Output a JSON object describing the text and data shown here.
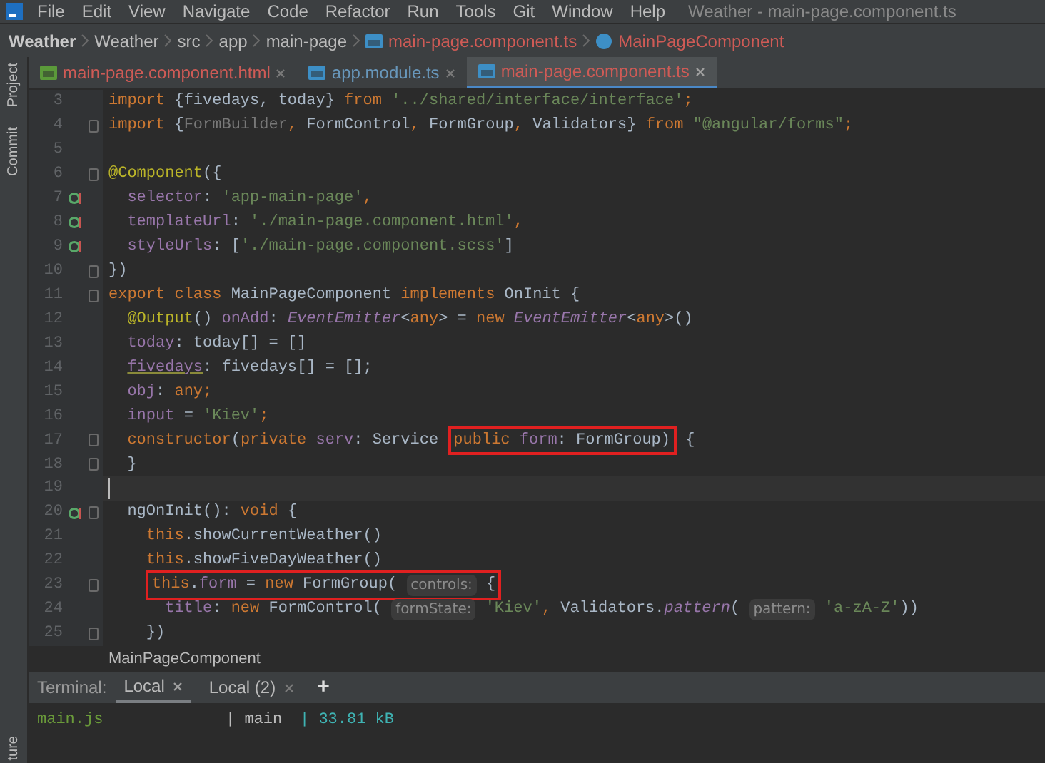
{
  "menu": {
    "items": [
      "File",
      "Edit",
      "View",
      "Navigate",
      "Code",
      "Refactor",
      "Run",
      "Tools",
      "Git",
      "Window",
      "Help"
    ],
    "title": "Weather - main-page.component.ts"
  },
  "breadcrumb": [
    {
      "text": "Weather",
      "kind": "project"
    },
    {
      "text": "Weather",
      "kind": "folder"
    },
    {
      "text": "src",
      "kind": "folder"
    },
    {
      "text": "app",
      "kind": "folder"
    },
    {
      "text": "main-page",
      "kind": "folder"
    },
    {
      "text": "main-page.component.ts",
      "kind": "file"
    },
    {
      "text": "MainPageComponent",
      "kind": "class"
    }
  ],
  "side_tools": [
    {
      "label": "Project"
    },
    {
      "label": "Commit"
    },
    {
      "label": "ture"
    }
  ],
  "tabs": [
    {
      "label": "main-page.component.html",
      "kind": "html",
      "selected": false
    },
    {
      "label": "app.module.ts",
      "kind": "ts-plain",
      "selected": false
    },
    {
      "label": "main-page.component.ts",
      "kind": "ts",
      "selected": true
    }
  ],
  "lines": [
    {
      "number": "3",
      "tokens": [
        {
          "kind": "kw",
          "text": "import "
        },
        {
          "kind": "plain",
          "text": "{fivedays, today} "
        },
        {
          "kind": "kw",
          "text": "from "
        },
        {
          "kind": "str",
          "text": "'../shared/interface/interface'"
        },
        {
          "kind": "kw",
          "text": ";"
        }
      ]
    },
    {
      "number": "4",
      "fold": true,
      "tokens": [
        {
          "kind": "kw",
          "text": "import "
        },
        {
          "kind": "plain",
          "text": "{"
        },
        {
          "kind": "unused",
          "text": "FormBuilder"
        },
        {
          "kind": "kw",
          "text": ", "
        },
        {
          "kind": "plain",
          "text": "FormControl"
        },
        {
          "kind": "kw",
          "text": ", "
        },
        {
          "kind": "plain",
          "text": "FormGroup"
        },
        {
          "kind": "kw",
          "text": ", "
        },
        {
          "kind": "plain",
          "text": "Validators} "
        },
        {
          "kind": "kw",
          "text": "from "
        },
        {
          "kind": "str",
          "text": "\"@angular/forms\""
        },
        {
          "kind": "kw",
          "text": ";"
        }
      ]
    },
    {
      "number": "5"
    },
    {
      "number": "6",
      "fold": true,
      "tokens": [
        {
          "kind": "deco",
          "text": "@Component"
        },
        {
          "kind": "plain",
          "text": "({"
        }
      ]
    },
    {
      "number": "7",
      "overridden": true,
      "tokens": [
        {
          "kind": "field",
          "text": "  selector"
        },
        {
          "kind": "plain",
          "text": ": "
        },
        {
          "kind": "str",
          "text": "'app-main-page'"
        },
        {
          "kind": "kw",
          "text": ","
        }
      ]
    },
    {
      "number": "8",
      "overridden": true,
      "tokens": [
        {
          "kind": "field",
          "text": "  templateUrl"
        },
        {
          "kind": "plain",
          "text": ": "
        },
        {
          "kind": "str",
          "text": "'./main-page.component.html'"
        },
        {
          "kind": "kw",
          "text": ","
        }
      ]
    },
    {
      "number": "9",
      "overridden": true,
      "tokens": [
        {
          "kind": "field",
          "text": "  styleUrls"
        },
        {
          "kind": "plain",
          "text": ": ["
        },
        {
          "kind": "str",
          "text": "'./main-page.component.scss'"
        },
        {
          "kind": "plain",
          "text": "]"
        }
      ]
    },
    {
      "number": "10",
      "fold": true,
      "tokens": [
        {
          "kind": "plain",
          "text": "})"
        }
      ]
    },
    {
      "number": "11",
      "fold": true,
      "tokens": [
        {
          "kind": "kw",
          "text": "export class "
        },
        {
          "kind": "plain",
          "text": "MainPageComponent "
        },
        {
          "kind": "kw",
          "text": "implements "
        },
        {
          "kind": "plain",
          "text": "OnInit {"
        }
      ]
    },
    {
      "number": "12",
      "tokens": [
        {
          "kind": "deco",
          "text": "  @Output"
        },
        {
          "kind": "plain",
          "text": "() "
        },
        {
          "kind": "field",
          "text": "onAdd"
        },
        {
          "kind": "plain",
          "text": ": "
        },
        {
          "kind": "type",
          "text": "EventEmitter"
        },
        {
          "kind": "plain",
          "text": "<"
        },
        {
          "kind": "kw",
          "text": "any"
        },
        {
          "kind": "plain",
          "text": "> = "
        },
        {
          "kind": "kw",
          "text": "new "
        },
        {
          "kind": "type",
          "text": "EventEmitter"
        },
        {
          "kind": "plain",
          "text": "<"
        },
        {
          "kind": "kw",
          "text": "any"
        },
        {
          "kind": "plain",
          "text": ">()"
        }
      ]
    },
    {
      "number": "13",
      "tokens": [
        {
          "kind": "field",
          "text": "  today"
        },
        {
          "kind": "plain",
          "text": ": today[] = []"
        }
      ]
    },
    {
      "number": "14",
      "tokens": [
        {
          "kind": "warn",
          "text": "  fivedays"
        },
        {
          "kind": "plain",
          "text": ": fivedays[] = [];"
        }
      ]
    },
    {
      "number": "15",
      "tokens": [
        {
          "kind": "field",
          "text": "  obj"
        },
        {
          "kind": "plain",
          "text": ": "
        },
        {
          "kind": "kw",
          "text": "any;"
        }
      ]
    },
    {
      "number": "16",
      "tokens": [
        {
          "kind": "field",
          "text": "  input"
        },
        {
          "kind": "plain",
          "text": " = "
        },
        {
          "kind": "str",
          "text": "'Kiev'"
        },
        {
          "kind": "kw",
          "text": ";"
        }
      ]
    },
    {
      "number": "17",
      "fold": true,
      "tokens": [
        {
          "kind": "kw",
          "text": "  constructor"
        },
        {
          "kind": "plain",
          "text": "("
        },
        {
          "kind": "kw",
          "text": "private "
        },
        {
          "kind": "field",
          "text": "serv"
        },
        {
          "kind": "plain",
          "text": ": Service "
        },
        {
          "kind": "box",
          "tokens": [
            {
              "kind": "kw",
              "text": "public "
            },
            {
              "kind": "field",
              "text": "form"
            },
            {
              "kind": "plain",
              "text": ": FormGroup)"
            }
          ]
        },
        {
          "kind": "plain",
          "text": " {"
        }
      ]
    },
    {
      "number": "18",
      "fold": true,
      "tokens": [
        {
          "kind": "plain",
          "text": "  }"
        }
      ]
    },
    {
      "number": "19",
      "current": true
    },
    {
      "number": "20",
      "overridden": true,
      "fold": true,
      "tokens": [
        {
          "kind": "plain",
          "text": "  ngOnInit(): "
        },
        {
          "kind": "kw",
          "text": "void "
        },
        {
          "kind": "plain",
          "text": "{"
        }
      ]
    },
    {
      "number": "21",
      "tokens": [
        {
          "kind": "kw",
          "text": "    this"
        },
        {
          "kind": "plain",
          "text": ".showCurrentWeather()"
        }
      ]
    },
    {
      "number": "22",
      "tokens": [
        {
          "kind": "kw",
          "text": "    this"
        },
        {
          "kind": "plain",
          "text": ".showFiveDayWeather()"
        }
      ]
    },
    {
      "number": "23",
      "fold": true,
      "tokens": [
        {
          "kind": "box",
          "tokens": [
            {
              "kind": "kw",
              "text": "    this"
            },
            {
              "kind": "plain",
              "text": "."
            },
            {
              "kind": "field",
              "text": "form"
            },
            {
              "kind": "plain",
              "text": " = "
            },
            {
              "kind": "kw",
              "text": "new "
            },
            {
              "kind": "plain",
              "text": "FormGroup( "
            },
            {
              "kind": "hint",
              "text": "controls:"
            },
            {
              "kind": "plain",
              "text": " {"
            }
          ]
        }
      ]
    },
    {
      "number": "24",
      "tokens": [
        {
          "kind": "field",
          "text": "      title"
        },
        {
          "kind": "plain",
          "text": ": "
        },
        {
          "kind": "kw",
          "text": "new "
        },
        {
          "kind": "plain",
          "text": "FormControl( "
        },
        {
          "kind": "hint",
          "text": "formState:"
        },
        {
          "kind": "str",
          "text": " 'Kiev'"
        },
        {
          "kind": "kw",
          "text": ", "
        },
        {
          "kind": "plain",
          "text": "Validators."
        },
        {
          "kind": "type",
          "text": "pattern"
        },
        {
          "kind": "plain",
          "text": "( "
        },
        {
          "kind": "hint",
          "text": "pattern:"
        },
        {
          "kind": "str",
          "text": " 'a-zA-Z'"
        },
        {
          "kind": "plain",
          "text": "))"
        }
      ]
    },
    {
      "number": "25",
      "fold": true,
      "tokens": [
        {
          "kind": "plain",
          "text": "    })"
        }
      ]
    }
  ],
  "editor_breadcrumb": "MainPageComponent",
  "terminal": {
    "label": "Terminal:",
    "tabs": [
      {
        "label": "Local",
        "selected": true
      },
      {
        "label": "Local (2)",
        "selected": false
      }
    ],
    "add": "+",
    "output": [
      {
        "file": "main.js",
        "chunk": "| main",
        "size": "| 33.81 kB"
      }
    ]
  }
}
